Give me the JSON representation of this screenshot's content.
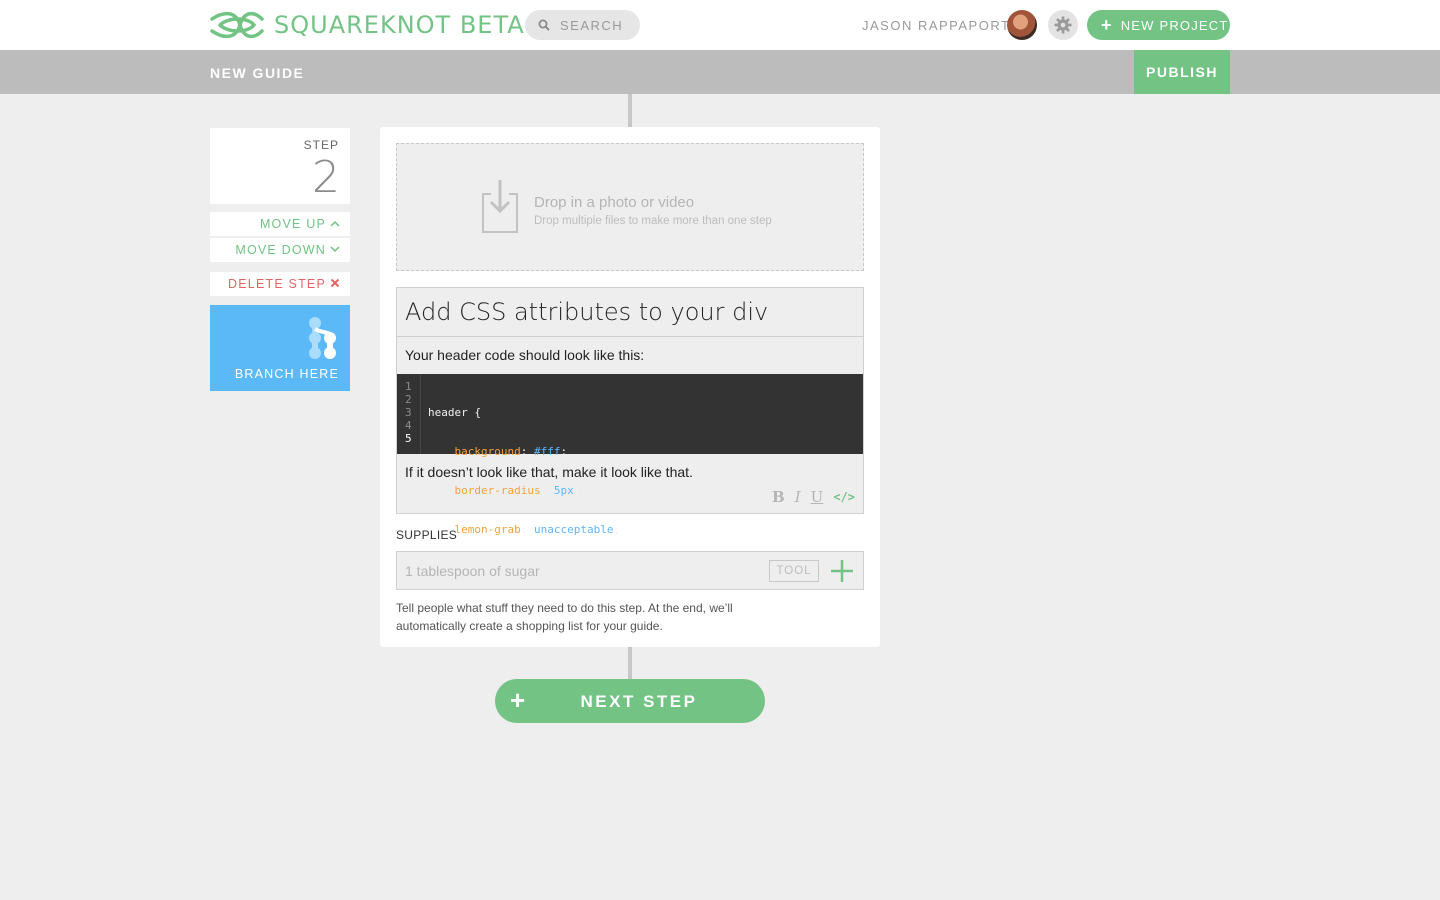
{
  "header": {
    "brand": "SQUAREKNOT BETA",
    "search_placeholder": "SEARCH",
    "username": "JASON RAPPAPORT",
    "new_project_label": "NEW PROJECT"
  },
  "subheader": {
    "title": "NEW GUIDE",
    "publish_label": "PUBLISH"
  },
  "step_controls": {
    "step_label": "STEP",
    "step_number": "2",
    "move_up": "MOVE UP",
    "move_down": "MOVE DOWN",
    "delete_step": "DELETE STEP",
    "branch_here": "BRANCH HERE"
  },
  "step": {
    "drop_title": "Drop in a photo or video",
    "drop_subtitle": "Drop multiple files to make more than one step",
    "title": "Add CSS attributes to your div",
    "intro_text": "Your header code should look like this:",
    "code_line_numbers": [
      "1",
      "2",
      "3",
      "4",
      "5"
    ],
    "code": {
      "line1": "header {",
      "line2_prop": "background",
      "line2_val": "#fff",
      "line3_prop": "border-radius",
      "line3_val": "5px",
      "line4_prop": "lemon-grab",
      "line4_val": "unacceptable",
      "line5": "}"
    },
    "outro_text": "If it doesn’t look like that, make it look like that.",
    "format_buttons": {
      "bold": "B",
      "italic": "I",
      "underline": "U",
      "code": "</>"
    }
  },
  "supplies": {
    "label": "SUPPLIES",
    "input_placeholder": "1 tablespoon of sugar",
    "tool_label": "TOOL",
    "hint": "Tell people what stuff they need to do this step. At the end, we’ll automatically create a shopping list for your guide."
  },
  "next_step_label": "NEXT STEP",
  "colors": {
    "accent_green": "#72c384",
    "branch_blue": "#5cb9f8",
    "delete_red": "#e06666",
    "code_bg": "#333333"
  }
}
